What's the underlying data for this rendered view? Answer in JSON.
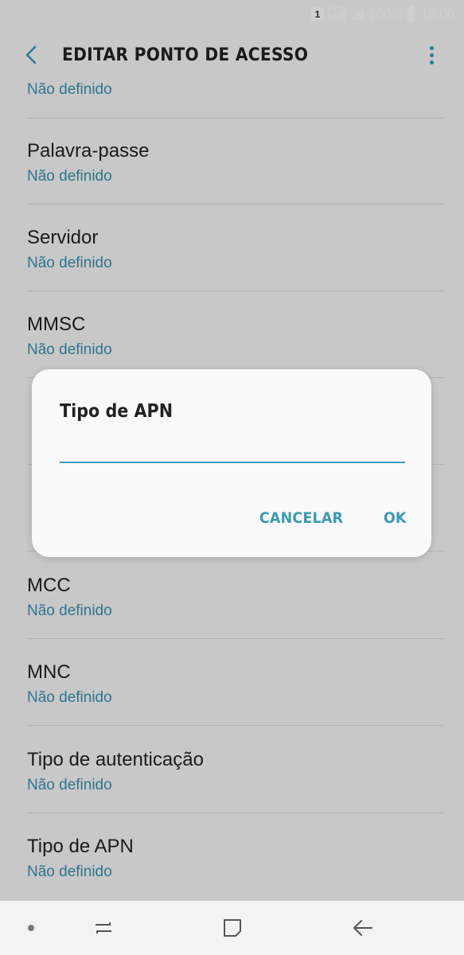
{
  "status_bar": {
    "sim_label": "1",
    "battery": "100%",
    "time": "10:00"
  },
  "app_bar": {
    "title": "EDITAR PONTO DE ACESSO"
  },
  "list": {
    "partial_value": "Não definido",
    "items": [
      {
        "label": "Palavra-passe",
        "value": "Não definido"
      },
      {
        "label": "Servidor",
        "value": "Não definido"
      },
      {
        "label": "MMSC",
        "value": "Não definido"
      },
      {
        "label": "",
        "value": ""
      },
      {
        "label": "",
        "value": ""
      },
      {
        "label": "MCC",
        "value": "Não definido"
      },
      {
        "label": "MNC",
        "value": "Não definido"
      },
      {
        "label": "Tipo de autenticação",
        "value": "Não definido"
      },
      {
        "label": "Tipo de APN",
        "value": "Não definido"
      }
    ]
  },
  "dialog": {
    "title": "Tipo de APN",
    "input_value": "",
    "cancel_label": "CANCELAR",
    "ok_label": "OK"
  },
  "colors": {
    "accent": "#3a9ab6",
    "value_text": "#3a8fb0"
  }
}
